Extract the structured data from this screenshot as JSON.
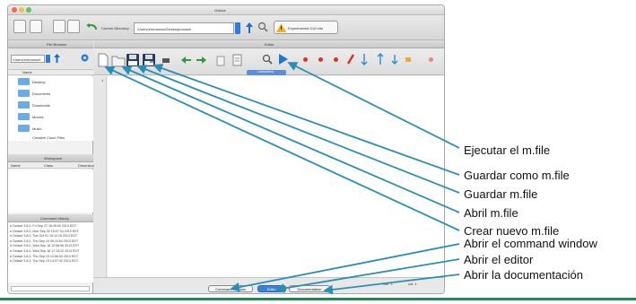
{
  "window": {
    "title": "Octave"
  },
  "toolbar": {
    "current_dir_label": "Current Directory:",
    "current_dir_value": "/Users/emmanuel/Desktop/octave",
    "news_label": "Experimental GUI info"
  },
  "file_browser": {
    "title": "File Browser",
    "path_value": "/Users/emmanuel",
    "column_name": "Name",
    "items": [
      "Desktop",
      "Documents",
      "Downloads",
      "Movies",
      "Music"
    ],
    "extra_item": "Creative Cloud Files"
  },
  "workspace": {
    "title": "Workspace",
    "columns": [
      "Name",
      "Class",
      "Dimension"
    ]
  },
  "command_history": {
    "title": "Command History",
    "lines": [
      "# Octave 3.8.0, Fri Sep 27 18:45:00 2013 EDT",
      "# Octave 3.8.0, Mon Sep 30 15:07:34 2013 EDT",
      "# Octave 3.8.0, Tue Oct 01 10:12:15 2013 EDT",
      "# Octave 3.8.0, Thu Sep 19 09:10:04 2013 EDT",
      "# Octave 3.8.0, Wed Sep 18 12:06:56 2013 EDT",
      "# Octave 3.8.0, Wed Sep 18 17:14:22 2013 EDT",
      "# Octave 3.8.0, Thu Sep 19 10:56:00 2013 EDT",
      "# Octave 3.8.0, Thu Sep 19 14:07:42 2013 EDT"
    ]
  },
  "editor": {
    "title": "Editor",
    "tab_label": "<unnamed>",
    "line_number": "1",
    "status_line": "line: 1",
    "status_col": "col: 1"
  },
  "bottom_tabs": {
    "command_window": "Command Window",
    "editor": "Editor",
    "documentation": "Documentation"
  },
  "annotations": {
    "ejecutar": "Ejecutar el m.file",
    "guardar_como": "Guardar como m.file",
    "guardar": "Guardar m.file",
    "abrir": "Abril m.file",
    "crear": "Crear nuevo m.file",
    "command_window": "Abrir el command window",
    "editor": "Abrir el editor",
    "documentacion": "Abrir la documentación"
  },
  "colors": {
    "arrow": "#2a8fb4",
    "accent": "#1777c8",
    "footer_line": "#1f8a4f"
  }
}
